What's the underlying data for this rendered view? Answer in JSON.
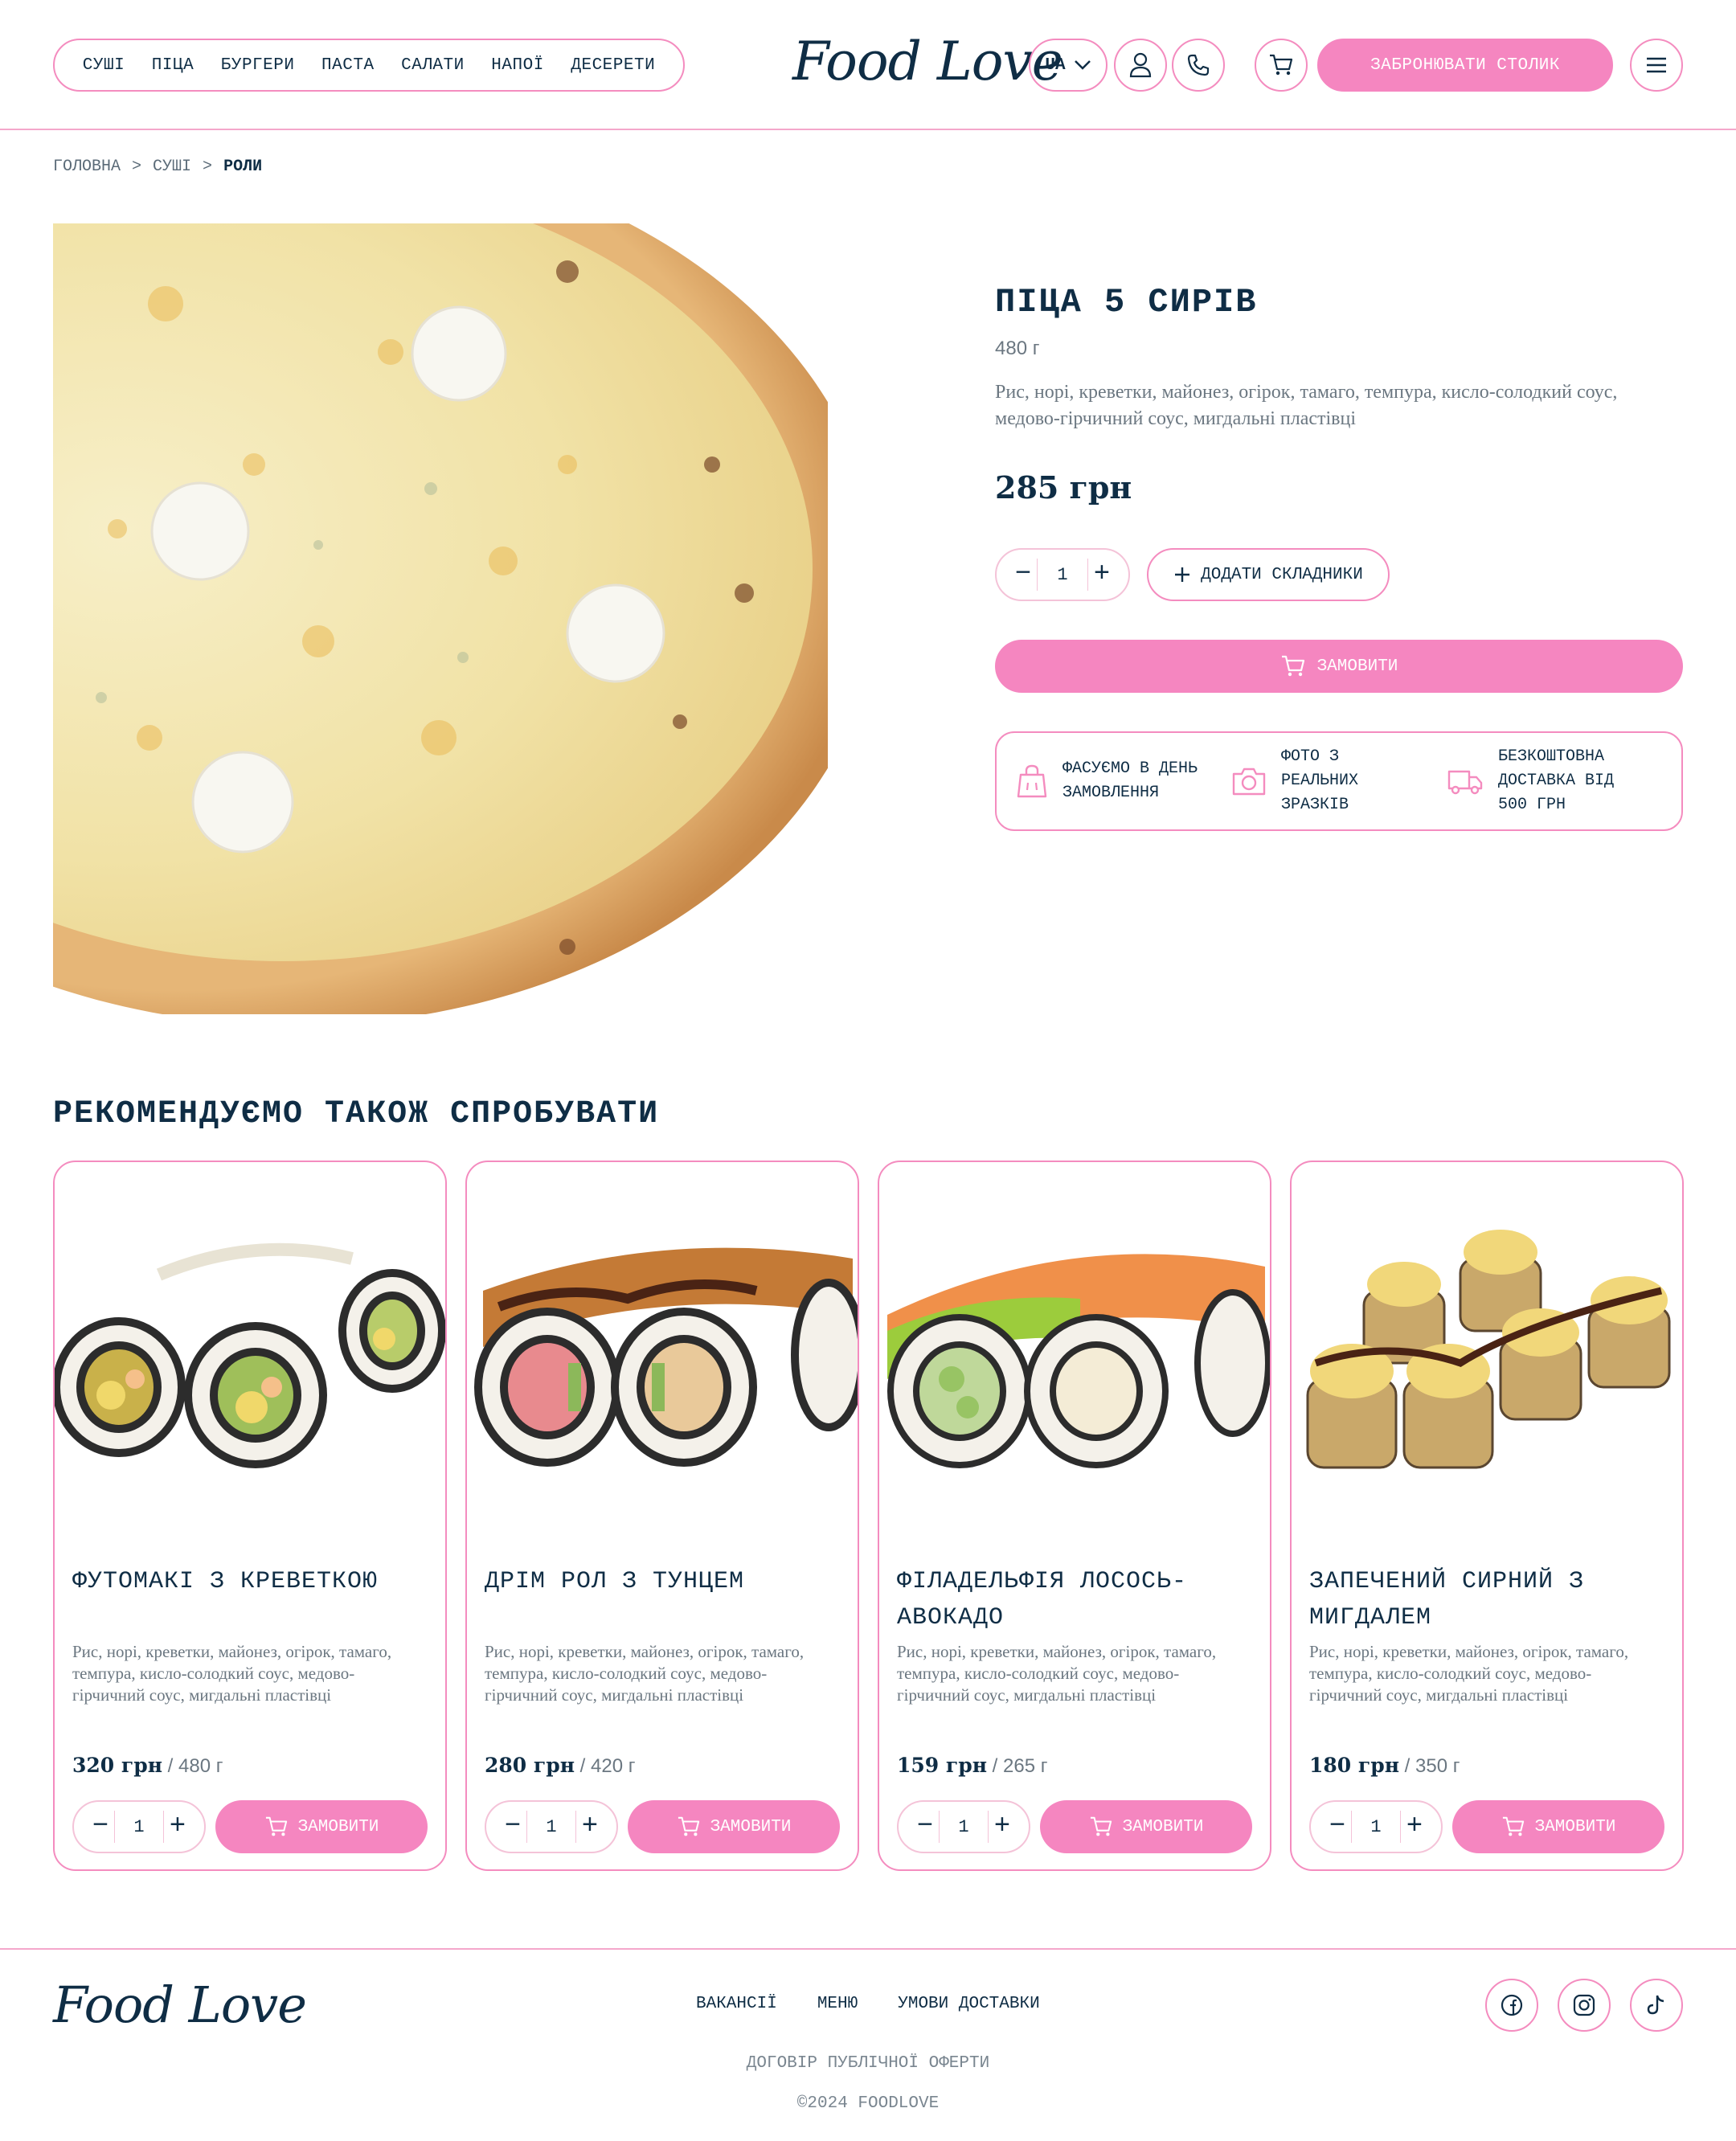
{
  "header": {
    "nav": [
      "СУШІ",
      "ПІЦА",
      "БУРГЕРИ",
      "ПАСТА",
      "САЛАТИ",
      "НАПОЇ",
      "ДЕСЕРЕТИ"
    ],
    "logo": "Food Love",
    "lang": "UA",
    "book_label": "ЗАБРОНЮВАТИ СТОЛИК"
  },
  "breadcrumb": [
    "ГОЛОВНА",
    ">",
    "СУШІ",
    ">",
    "РОЛИ"
  ],
  "product": {
    "title": "ПІЦА 5 СИРІВ",
    "weight": "480 г",
    "description": "Рис, норі, креветки, майонез, огірок, тамаго, темпура, кисло-солодкий соус, медово-гірчичний соус, мигдальні пластівці",
    "price": "285 грн",
    "qty": "1",
    "add_ingredients": "ДОДАТИ СКЛАДНИКИ",
    "order": "ЗАМОВИТИ",
    "features": [
      {
        "icon": "bag-icon",
        "text": "ФАСУЄМО В ДЕНЬ ЗАМОВЛЕННЯ"
      },
      {
        "icon": "camera-icon",
        "text": "ФОТО З РЕАЛЬНИХ ЗРАЗКІВ"
      },
      {
        "icon": "truck-icon",
        "text": "БЕЗКОШТОВНА ДОСТАВКА ВІД 500 ГРН"
      }
    ]
  },
  "recommend": {
    "title": "РЕКОМЕНДУЄМО ТАКОЖ СПРОБУВАТИ",
    "cards": [
      {
        "title": "ФУТОМАКІ З КРЕВЕТКОЮ",
        "desc": "Рис, норі, креветки, майонез, огірок, тамаго, темпура, кисло-солодкий соус, медово-гірчичний соус, мигдальні пластівці",
        "price": "320 грн",
        "weight": "/ 480 г",
        "qty": "1",
        "order": "ЗАМОВИТИ"
      },
      {
        "title": "ДРІМ РОЛ З ТУНЦЕМ",
        "desc": "Рис, норі, креветки, майонез, огірок, тамаго, темпура, кисло-солодкий соус, медово-гірчичний соус, мигдальні пластівці",
        "price": "280 грн",
        "weight": "/ 420 г",
        "qty": "1",
        "order": "ЗАМОВИТИ"
      },
      {
        "title": "ФІЛАДЕЛЬФІЯ ЛОСОСЬ-АВОКАДО",
        "desc": "Рис, норі, креветки, майонез, огірок, тамаго, темпура, кисло-солодкий соус, медово-гірчичний соус, мигдальні пластівці",
        "price": "159 грн",
        "weight": "/ 265 г",
        "qty": "1",
        "order": "ЗАМОВИТИ"
      },
      {
        "title": "ЗАПЕЧЕНИЙ СИРНИЙ З МИГДАЛЕМ",
        "desc": "Рис, норі, креветки, майонез, огірок, тамаго, темпура, кисло-солодкий соус, медово-гірчичний соус, мигдальні пластівці",
        "price": "180 грн",
        "weight": "/ 350 г",
        "qty": "1",
        "order": "ЗАМОВИТИ"
      }
    ]
  },
  "footer": {
    "logo": "Food Love",
    "nav": [
      "ВАКАНСІЇ",
      "МЕНЮ",
      "УМОВИ ДОСТАВКИ"
    ],
    "offer": "ДОГОВІР ПУБЛІЧНОЇ ОФЕРТИ",
    "copyright": "©2024 FOODLOVE"
  },
  "colors": {
    "accent": "#f586c0",
    "border": "#f48cbf",
    "text": "#0f2d45",
    "muted": "#6b7781"
  }
}
